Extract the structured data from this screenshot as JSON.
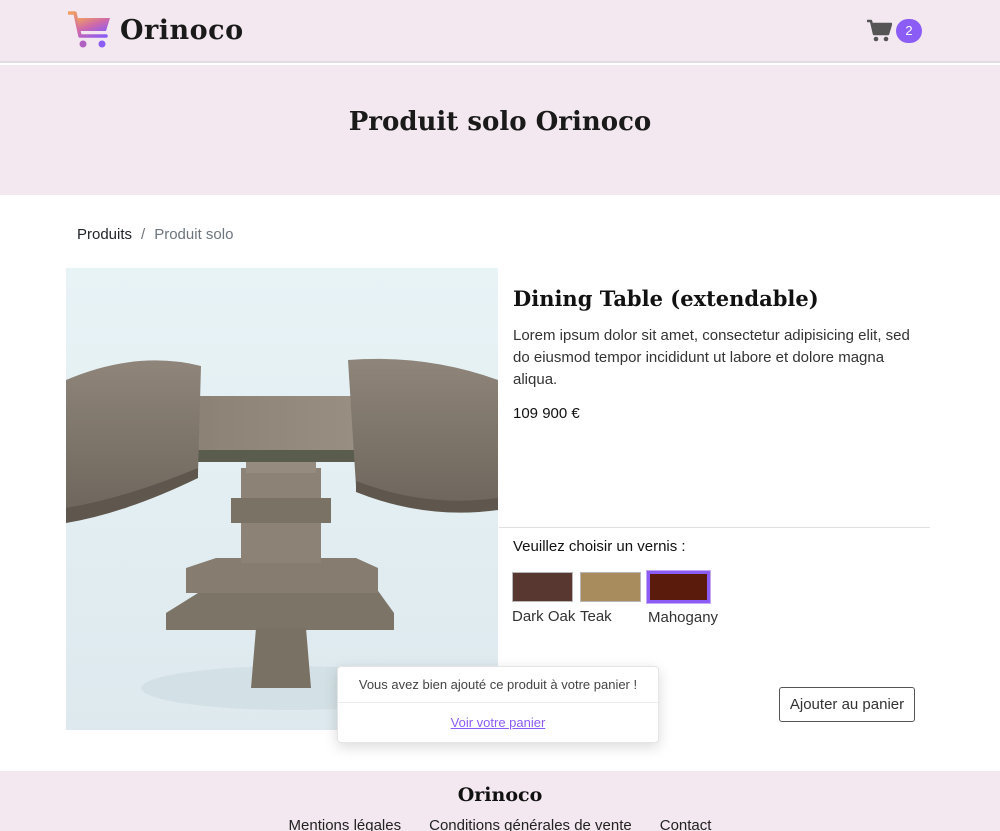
{
  "navbar": {
    "brand": "Orinoco",
    "cart_count": "2"
  },
  "hero": {
    "title": "Produit solo Orinoco"
  },
  "breadcrumb": {
    "items": [
      "Produits",
      "Produit solo"
    ],
    "separator": "/"
  },
  "product": {
    "title": "Dining Table (extendable)",
    "description": "Lorem ipsum dolor sit amet, consectetur adipisicing elit, sed do eiusmod tempor incididunt ut labore et dolore magna aliqua.",
    "price": "109 900 €",
    "image_subject": "extendable wooden dining table"
  },
  "varnish": {
    "label": "Veuillez choisir un vernis :",
    "options": [
      {
        "name": "Dark Oak",
        "color": "#57372f"
      },
      {
        "name": "Teak",
        "color": "#a88c5e"
      },
      {
        "name": "Mahogany",
        "color": "#5a1a0c"
      }
    ],
    "selected": "Mahogany"
  },
  "actions": {
    "add_to_cart": "Ajouter au panier"
  },
  "toast": {
    "message": "Vous avez bien ajouté ce produit à votre panier !",
    "link": "Voir votre panier"
  },
  "footer": {
    "brand": "Orinoco",
    "links": [
      "Mentions légales",
      "Conditions générales de vente",
      "Contact"
    ]
  },
  "colors": {
    "accent": "#8b5cf6",
    "header_bg": "#f3e8f0"
  },
  "icons": {
    "logo": "shopping-cart-gradient-icon",
    "cart": "shopping-cart-icon"
  }
}
